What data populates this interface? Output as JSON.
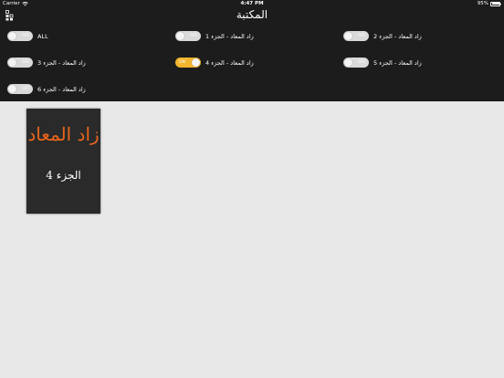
{
  "status": {
    "carrier": "Carrier",
    "time": "4:47 PM",
    "battery": "95%"
  },
  "nav": {
    "title": "المكتبة"
  },
  "filters": [
    {
      "label": "ALL",
      "state": "OFF",
      "on": false
    },
    {
      "label": "زاد المعاد  - الجزء 1",
      "state": "OFF",
      "on": false
    },
    {
      "label": "زاد المعاد  - الجزء 2",
      "state": "OFF",
      "on": false
    },
    {
      "label": "زاد المعاد  - الجزء 3",
      "state": "OFF",
      "on": false
    },
    {
      "label": "زاد المعاد  - الجزء 4",
      "state": "ON",
      "on": true
    },
    {
      "label": "زاد المعاد  - الجزء 5",
      "state": "OFF",
      "on": false
    },
    {
      "label": "زاد المعاد  - الجزء 6",
      "state": "OFF",
      "on": false
    }
  ],
  "books": [
    {
      "title": "زاد المعاد",
      "part": "الجزء 4"
    }
  ],
  "colors": {
    "header_bg": "#1c1c1c",
    "toggle_on": "#f3b62f",
    "toggle_off": "#d9d9d9",
    "book_title": "#e8651a",
    "content_bg": "#e8e8e8"
  }
}
